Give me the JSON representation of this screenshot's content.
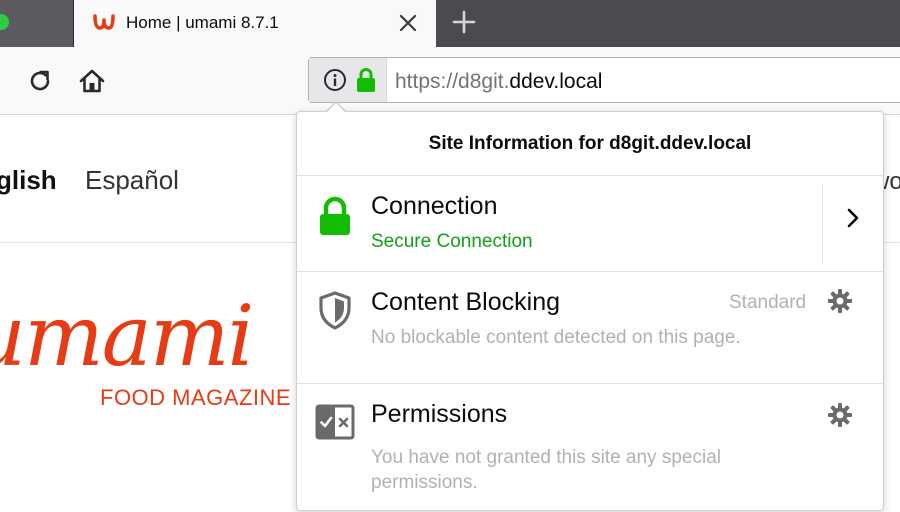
{
  "browser": {
    "tab": {
      "title": "Home | umami 8.7.1",
      "favicon_icon": "umami-favicon-icon",
      "close_icon": "close-icon"
    },
    "new_tab_icon": "plus-icon",
    "toolbar": {
      "reload_icon": "reload-icon",
      "home_icon": "home-icon"
    },
    "urlbar": {
      "url_prefix": "https://d8git.",
      "url_domain": "ddev.local",
      "info_icon": "info-icon",
      "lock_icon": "lock-icon"
    }
  },
  "page": {
    "languages": [
      "glish",
      "Español",
      "wo"
    ],
    "logo_text": "umami",
    "tagline": "FOOD MAGAZINE"
  },
  "site_info_panel": {
    "title": "Site Information for d8git.ddev.local",
    "connection": {
      "title": "Connection",
      "subtitle": "Secure Connection",
      "icon": "lock-icon",
      "chevron_icon": "chevron-right-icon"
    },
    "content_blocking": {
      "title": "Content Blocking",
      "status": "Standard",
      "description": "No blockable content detected on this page.",
      "icon": "shield-icon",
      "gear_icon": "gear-icon"
    },
    "permissions": {
      "title": "Permissions",
      "description_line1": "You have not granted this site any special",
      "description_line2": "permissions.",
      "icon": "permissions-icon",
      "gear_icon": "gear-icon"
    }
  },
  "colors": {
    "secure_green": "#12a018",
    "brand_red": "#e63b14",
    "tabbar": "#4a4a4f"
  }
}
